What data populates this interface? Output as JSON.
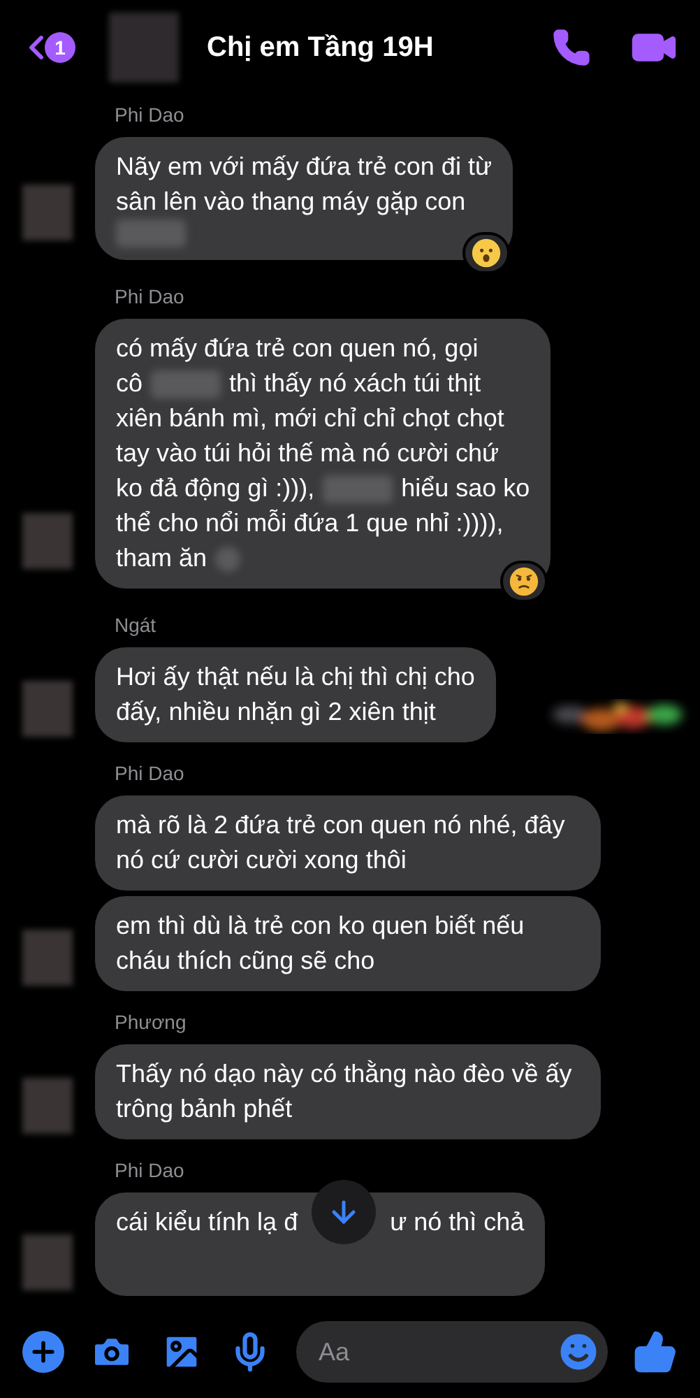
{
  "header": {
    "back_badge": "1",
    "title": "Chị em Tầng 19H"
  },
  "groups": [
    {
      "sender": "Phi Dao",
      "messages": [
        {
          "lines": [
            [
              {
                "kind": "text",
                "text": "Nãy em với mấy đứa trẻ con đi từ"
              }
            ],
            [
              {
                "kind": "text",
                "text": "sân lên vào thang máy gặp con"
              }
            ],
            [
              {
                "kind": "redacted"
              }
            ]
          ],
          "reaction": {
            "kind": "surprised"
          }
        }
      ]
    },
    {
      "sender": "Phi Dao",
      "messages": [
        {
          "lines": [
            [
              {
                "kind": "text",
                "text": "có mấy đứa trẻ con quen nó, gọi"
              }
            ],
            [
              {
                "kind": "text",
                "text": "cô"
              },
              {
                "kind": "redacted"
              },
              {
                "kind": "text",
                "text": "thì thấy nó xách túi thịt"
              }
            ],
            [
              {
                "kind": "text",
                "text": "xiên bánh mì, mới chỉ chỉ chọt chọt"
              }
            ],
            [
              {
                "kind": "text",
                "text": "tay vào túi hỏi thế mà nó cười chứ"
              }
            ],
            [
              {
                "kind": "text",
                "text": "ko đả động gì :))),"
              },
              {
                "kind": "redacted"
              },
              {
                "kind": "text",
                "text": "hiểu sao ko"
              }
            ],
            [
              {
                "kind": "text",
                "text": "thể cho nổi mỗi đứa 1 que nhỉ :)))),"
              }
            ],
            [
              {
                "kind": "text",
                "text": "tham ăn"
              },
              {
                "kind": "redacted_small"
              }
            ]
          ],
          "reaction": {
            "kind": "angry"
          }
        }
      ]
    },
    {
      "sender": "Ngát",
      "messages": [
        {
          "lines": [
            [
              {
                "kind": "text",
                "text": "Hơi ấy thật nếu là chị thì chị cho"
              }
            ],
            [
              {
                "kind": "text",
                "text": "đấy, nhiều nhặn gì 2 xiên thịt"
              }
            ]
          ],
          "sticker": {
            "kind": "picture"
          }
        }
      ]
    },
    {
      "sender": "Phi Dao",
      "messages": [
        {
          "lines": [
            [
              {
                "kind": "text",
                "text": "mà rõ là 2 đứa trẻ con quen nó nhé, đây nó cứ cười cười xong thôi"
              }
            ]
          ]
        },
        {
          "lines": [
            [
              {
                "kind": "text",
                "text": "em thì dù là trẻ con ko quen biết nếu cháu thích cũng sẽ cho"
              }
            ]
          ]
        }
      ]
    },
    {
      "sender": "Phương",
      "messages": [
        {
          "lines": [
            [
              {
                "kind": "text",
                "text": "Thấy nó dạo này có thằng nào đèo về ấy trông bảnh phết"
              }
            ]
          ]
        }
      ]
    },
    {
      "sender": "Phi Dao",
      "messages": [
        {
          "lines": [
            [
              {
                "kind": "text",
                "text": "cái kiểu tính lạ đ"
              },
              {
                "kind": "covered"
              },
              {
                "kind": "text",
                "text": "ư nó thì chả"
              }
            ]
          ]
        }
      ]
    }
  ],
  "composer": {
    "placeholder": "Aa"
  }
}
